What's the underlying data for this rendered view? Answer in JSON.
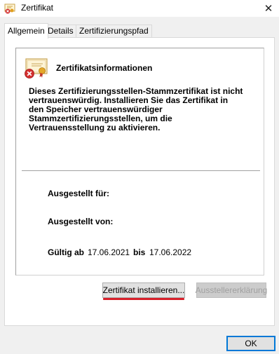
{
  "window": {
    "title": "Zertifikat",
    "close_symbol": "✕"
  },
  "tabs": [
    {
      "label": "Allgemein",
      "active": true
    },
    {
      "label": "Details",
      "active": false
    },
    {
      "label": "Zertifizierungspfad",
      "active": false
    }
  ],
  "info": {
    "heading": "Zertifikatsinformationen",
    "warning_lines": [
      "Dieses Zertifizierungsstellen-Stammzertifikat ist nicht",
      "vertrauenswürdig. Installieren Sie das Zertifikat in",
      "den Speicher vertrauenswürdiger",
      "Stammzertifizierungsstellen, um die",
      "Vertrauensstellung zu aktivieren."
    ],
    "issued_to_label": "Ausgestellt für:",
    "issued_by_label": "Ausgestellt von:",
    "valid_from_label": "Gültig ab",
    "valid_from": "17.06.2021",
    "valid_to_label": "bis",
    "valid_to": "17.06.2022"
  },
  "buttons": {
    "install": "Zertifikat installieren...",
    "issuer_statement": "Ausstellererklärung",
    "ok": "OK"
  },
  "icons": {
    "title": "certificate-error-icon",
    "info": "certificate-error-icon"
  },
  "colors": {
    "highlight_underline": "#d8202a",
    "ok_border": "#0078d7"
  }
}
